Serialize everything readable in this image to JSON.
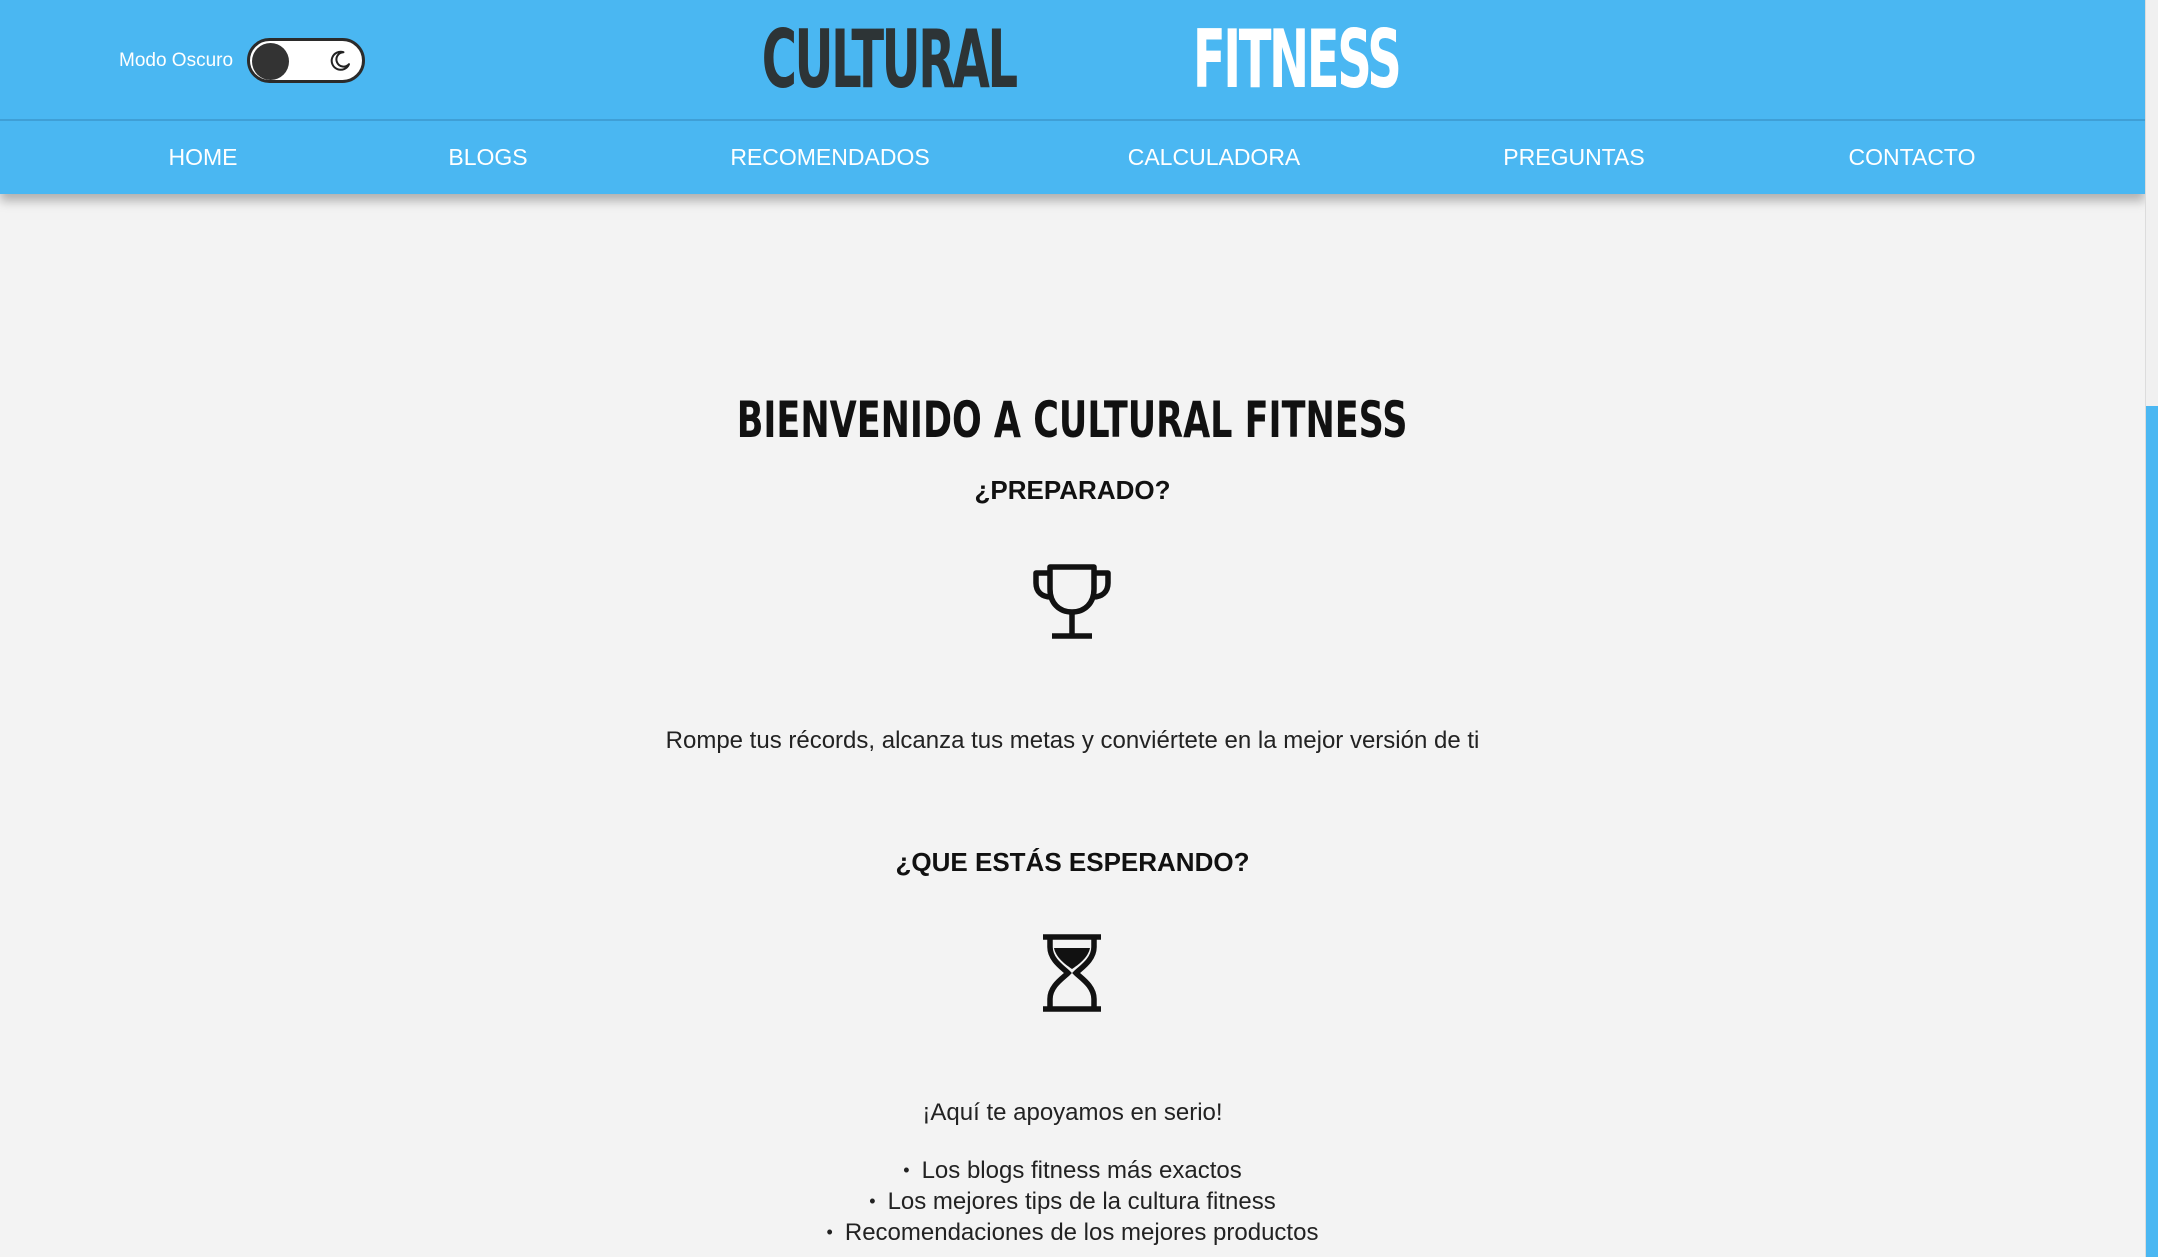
{
  "header": {
    "dark_mode_label": "Modo Oscuro",
    "brand_first": "CULTURAL",
    "brand_second": "FITNESS"
  },
  "nav": {
    "home": "HOME",
    "blogs": "BLOGS",
    "recomendados": "RECOMENDADOS",
    "calculadora": "CALCULADORA",
    "preguntas": "PREGUNTAS",
    "contacto": "CONTACTO"
  },
  "main": {
    "welcome_title": "BIENVENIDO A CULTURAL FITNESS",
    "prepared_heading": "¿PREPARADO?",
    "intro_text": "Rompe tus récords, alcanza tus metas y conviértete en la mejor versión de ti",
    "waiting_heading": "¿QUE ESTÁS ESPERANDO?",
    "support_text": "¡Aquí te apoyamos en serio!",
    "features": [
      "Los blogs fitness más exactos",
      "Los mejores tips de la cultura fitness",
      "Recomendaciones de los mejores productos"
    ]
  },
  "colors": {
    "header_bg": "#4ab7f2",
    "brand_dark": "#2d3436",
    "page_bg": "#f3f3f3"
  },
  "icons": {
    "toggle": "moon-icon",
    "section_one": "trophy-icon",
    "section_two": "hourglass-icon"
  }
}
